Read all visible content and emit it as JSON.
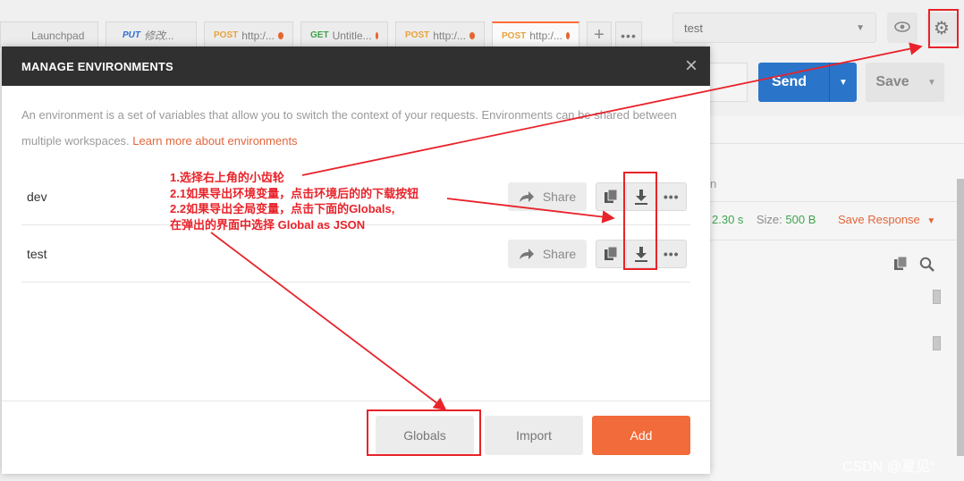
{
  "app": {
    "tabs": [
      {
        "method": "",
        "label": "Launchpad",
        "dot": false
      },
      {
        "method": "PUT",
        "label": "修改...",
        "dot": false
      },
      {
        "method": "POST",
        "label": "http:/...",
        "dot": true
      },
      {
        "method": "GET",
        "label": "Untitle...",
        "dot": true
      },
      {
        "method": "POST",
        "label": "http:/...",
        "dot": true
      },
      {
        "method": "POST",
        "label": "http:/...",
        "dot": true
      }
    ],
    "add_tab": "+",
    "more_tabs": "•••",
    "environment_selected": "test",
    "send_label": "Send",
    "save_label": "Save",
    "response": {
      "partial_label": "n",
      "time": "2.30 s",
      "size_label": "Size:",
      "size_value": "500 B",
      "save_response": "Save Response"
    }
  },
  "modal": {
    "title": "MANAGE ENVIRONMENTS",
    "close": "×",
    "description": "An environment is a set of variables that allow you to switch the context of your requests. Environments can be shared between multiple workspaces.",
    "learn_more": "Learn more about environments",
    "environments": [
      {
        "name": "dev",
        "share_label": "Share"
      },
      {
        "name": "test",
        "share_label": "Share"
      }
    ],
    "footer": {
      "globals": "Globals",
      "import": "Import",
      "add": "Add"
    }
  },
  "annotation": {
    "lines": [
      "1.选择右上角的小齿轮",
      "2.1如果导出环境变量，点击环境后的的下载按钮",
      "2.2如果导出全局变量，点击下面的Globals,",
      "在弹出的界面中选择 Global as JSON"
    ]
  },
  "watermark": "CSDN @夏见°",
  "colors": {
    "accent": "#f26b3a",
    "send_blue": "#2a75c9",
    "annotation_red": "#e8232a",
    "modal_header": "#303030",
    "status_green": "#3ea54d"
  }
}
